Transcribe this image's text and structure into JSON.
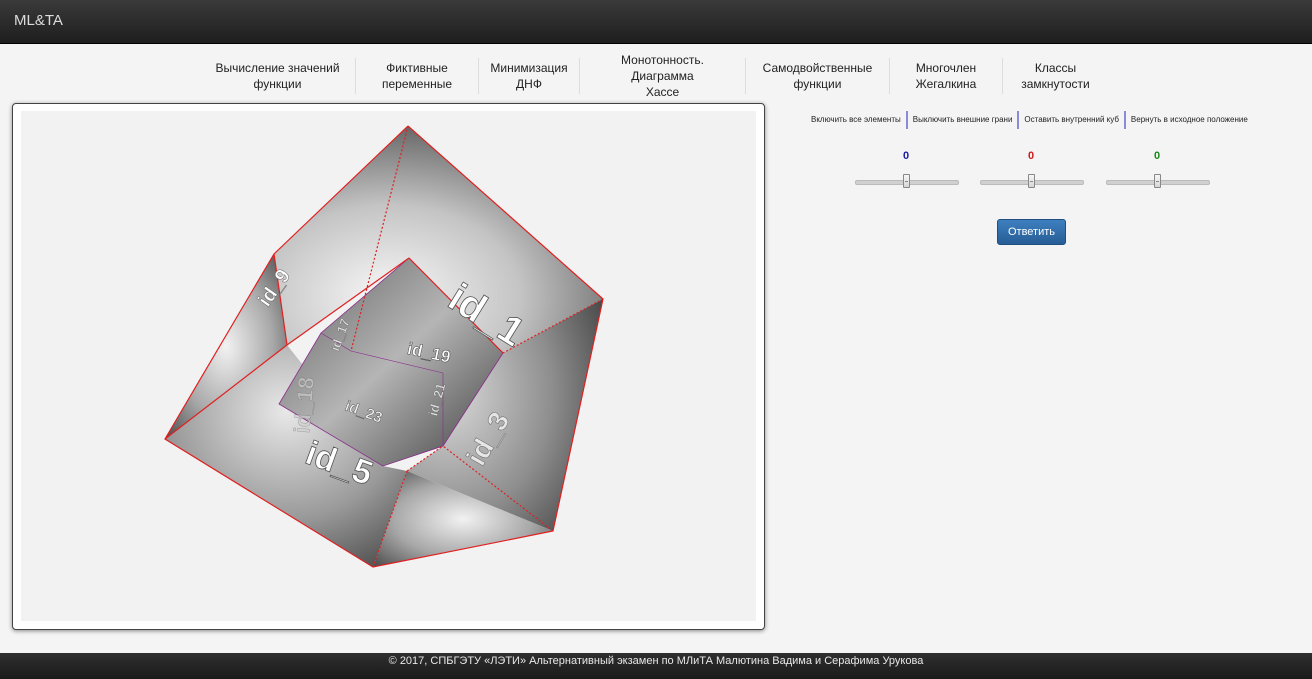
{
  "navbar": {
    "brand": "ML&TA"
  },
  "tabs": [
    {
      "label": "Вычисление значений\nфункции"
    },
    {
      "label": "Фиктивные\nпеременные"
    },
    {
      "label": "Минимизация\nДНФ"
    },
    {
      "label": "Монотонность. Диаграмма\nХассе"
    },
    {
      "label": "Самодвойственные\nфункции"
    },
    {
      "label": "Многочлен\nЖегалкина"
    },
    {
      "label": "Классы\nзамкнутости"
    }
  ],
  "actions": [
    {
      "label": "Включить все элементы"
    },
    {
      "label": "Выключить внешние грани"
    },
    {
      "label": "Оставить внутренний куб"
    },
    {
      "label": "Вернуть в исходное положение"
    }
  ],
  "sliders": [
    {
      "value": "0",
      "color": "#1a1aa6",
      "level": 0.5
    },
    {
      "value": "0",
      "color": "#d01818",
      "level": 0.5
    },
    {
      "value": "0",
      "color": "#1a8a1a",
      "level": 0.5
    }
  ],
  "answer_button": "Ответить",
  "cube_labels": {
    "top": "id_1",
    "bottom": "id_5",
    "inner_main": "id_19",
    "inner_bottom": "id_23",
    "inner_side": "id_21",
    "right": "id_3",
    "left_face": "id_9",
    "inner_left": "id_17",
    "back": "id_18"
  },
  "footer": "© 2017, СПБГЭТУ «ЛЭТИ» Альтернативный экзамен по МЛиТА Малютина Вадима и Серафима Урукова"
}
